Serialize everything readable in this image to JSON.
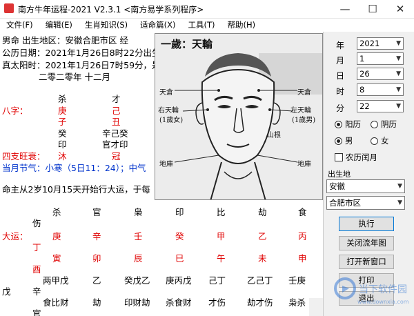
{
  "window": {
    "title": "南方牛年运程-2021  V2.3.1  <南方易学系列程序>",
    "minimize": "—",
    "maximize": "☐",
    "close": "✕"
  },
  "menu": [
    "文件(F)",
    "编辑(E)",
    "生肖知识(S)",
    "适命篇(X)",
    "工具(T)",
    "帮助(H)"
  ],
  "info": {
    "line1": "男命      出生地区：安徽合肥市区  经",
    "line2": "公历日期：2021年1月26日8时22分出生",
    "line3": "真太阳时：2021年1月26日7时59分，是",
    "line4": "二零二零年          十二月",
    "ten_gods_top": [
      "杀",
      "才"
    ],
    "bazi_label": "八字：",
    "stems": [
      "庚",
      "己"
    ],
    "branches": [
      "子",
      "丑"
    ],
    "hidden_1": [
      "癸",
      "辛己癸"
    ],
    "hidden_2": [
      "印",
      "官才印"
    ],
    "sizhi_label": "四支旺衰：",
    "sizhi_vals": [
      "沐",
      "冠"
    ],
    "jieqi": "当月节气：小寒（5日11：24）；中气",
    "dayun_intro": "命主从2岁10月15天开始行大运，于每"
  },
  "dayun": {
    "gods_row": [
      "杀",
      "官",
      "枭",
      "印",
      "比",
      "劫",
      "食"
    ],
    "gods_wrap": "伤",
    "label": "大运：",
    "stems": [
      "庚",
      "辛",
      "壬",
      "癸",
      "甲",
      "乙",
      "丙"
    ],
    "stems_wrap": "丁",
    "branches": [
      "寅",
      "卯",
      "辰",
      "巳",
      "午",
      "未",
      "申"
    ],
    "branches_wrap": "酉",
    "hidden": [
      "两甲戊",
      "乙",
      "癸戊乙",
      "庚丙戊",
      "己丁",
      "乙己丁",
      "壬庚"
    ],
    "hidden_lead": "戊",
    "hidden_wrap": "辛",
    "hidden_gods": [
      "食比财",
      "劫",
      "印财劫",
      "杀食财",
      "才伤",
      "劫才伤",
      "枭杀"
    ],
    "hidden_gods_wrap": "官"
  },
  "face": {
    "title": "一歲：天輪",
    "labels": [
      "天倉",
      "天倉",
      "右天輪",
      "(1歲女)",
      "左天輪",
      "(1歲男)",
      "山根",
      "地庫",
      "地庫"
    ]
  },
  "form": {
    "year_label": "年",
    "year": "2021",
    "month_label": "月",
    "month": "1",
    "day_label": "日",
    "day": "26",
    "hour_label": "时",
    "hour": "8",
    "minute_label": "分",
    "minute": "22",
    "yangli": "阳历",
    "yinli": "阴历",
    "male": "男",
    "female": "女",
    "leap": "农历闰月",
    "birthplace_label": "出生地",
    "province": "安徽",
    "city": "合肥市区"
  },
  "buttons": {
    "run": "执行",
    "close_chart": "关闭流年图",
    "new_window": "打开新窗口",
    "print": "打印",
    "exit": "退出"
  },
  "watermark": {
    "text": "当下软件园",
    "url_text": "www.downxia.com"
  }
}
